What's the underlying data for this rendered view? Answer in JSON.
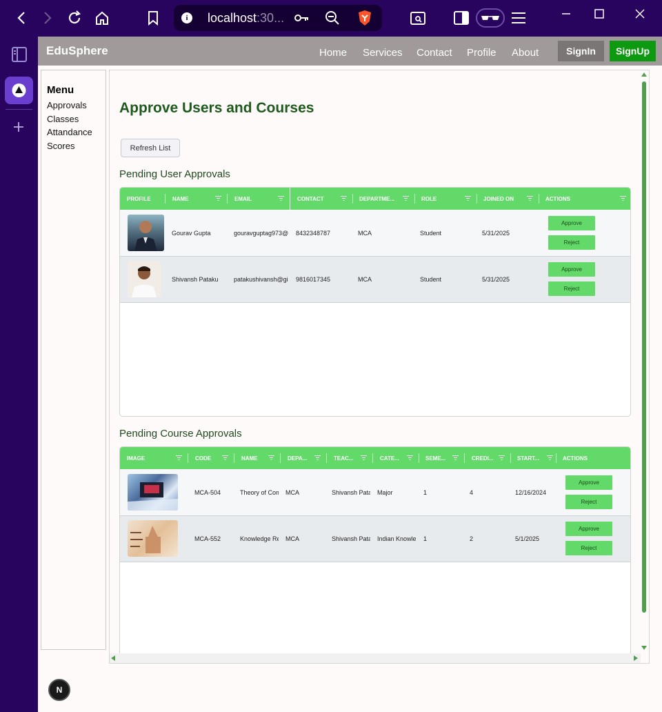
{
  "browser": {
    "url_host": "localhost",
    "url_rest": ":30..."
  },
  "app": {
    "brand": "EduSphere",
    "nav": [
      "Home",
      "Services",
      "Contact",
      "Profile",
      "About"
    ],
    "signin": "SignIn",
    "signup": "SignUp"
  },
  "menu": {
    "title": "Menu",
    "items": [
      "Approvals",
      "Classes",
      "Attandance",
      "Scores"
    ]
  },
  "main": {
    "title": "Approve Users and Courses",
    "refresh_label": "Refresh List"
  },
  "users": {
    "title": "Pending User Approvals",
    "columns": [
      "PROFILE",
      "NAME",
      "EMAIL",
      "CONTACT",
      "DEPARTME...",
      "ROLE",
      "JOINED ON",
      "ACTIONS"
    ],
    "rows": [
      {
        "name": "Gourav Gupta",
        "email": "gouravguptag973@",
        "contact": "8432348787",
        "department": "MCA",
        "role": "Student",
        "joined": "5/31/2025",
        "approve": "Approve",
        "reject": "Reject"
      },
      {
        "name": "Shivansh Pataku",
        "email": "patakushivansh@gi",
        "contact": "9816017345",
        "department": "MCA",
        "role": "Student",
        "joined": "5/31/2025",
        "approve": "Approve",
        "reject": "Reject"
      }
    ]
  },
  "courses": {
    "title": "Pending Course Approvals",
    "columns": [
      "IMAGE",
      "CODE",
      "NAME",
      "DEPA...",
      "TEAC...",
      "CATE...",
      "SEME...",
      "CREDI...",
      "START...",
      "ACTIONS"
    ],
    "rows": [
      {
        "code": "MCA-504",
        "name": "Theory of Com",
        "department": "MCA",
        "teacher": "Shivansh Patak",
        "category": "Major",
        "semester": "1",
        "credits": "4",
        "start": "12/16/2024",
        "approve": "Approve",
        "reject": "Reject"
      },
      {
        "code": "MCA-552",
        "name": "Knowledge Rep",
        "department": "MCA",
        "teacher": "Shivansh Patak",
        "category": "Indian Knowlec",
        "semester": "1",
        "credits": "2",
        "start": "5/1/2025",
        "approve": "Approve",
        "reject": "Reject"
      }
    ]
  },
  "badge": "N"
}
